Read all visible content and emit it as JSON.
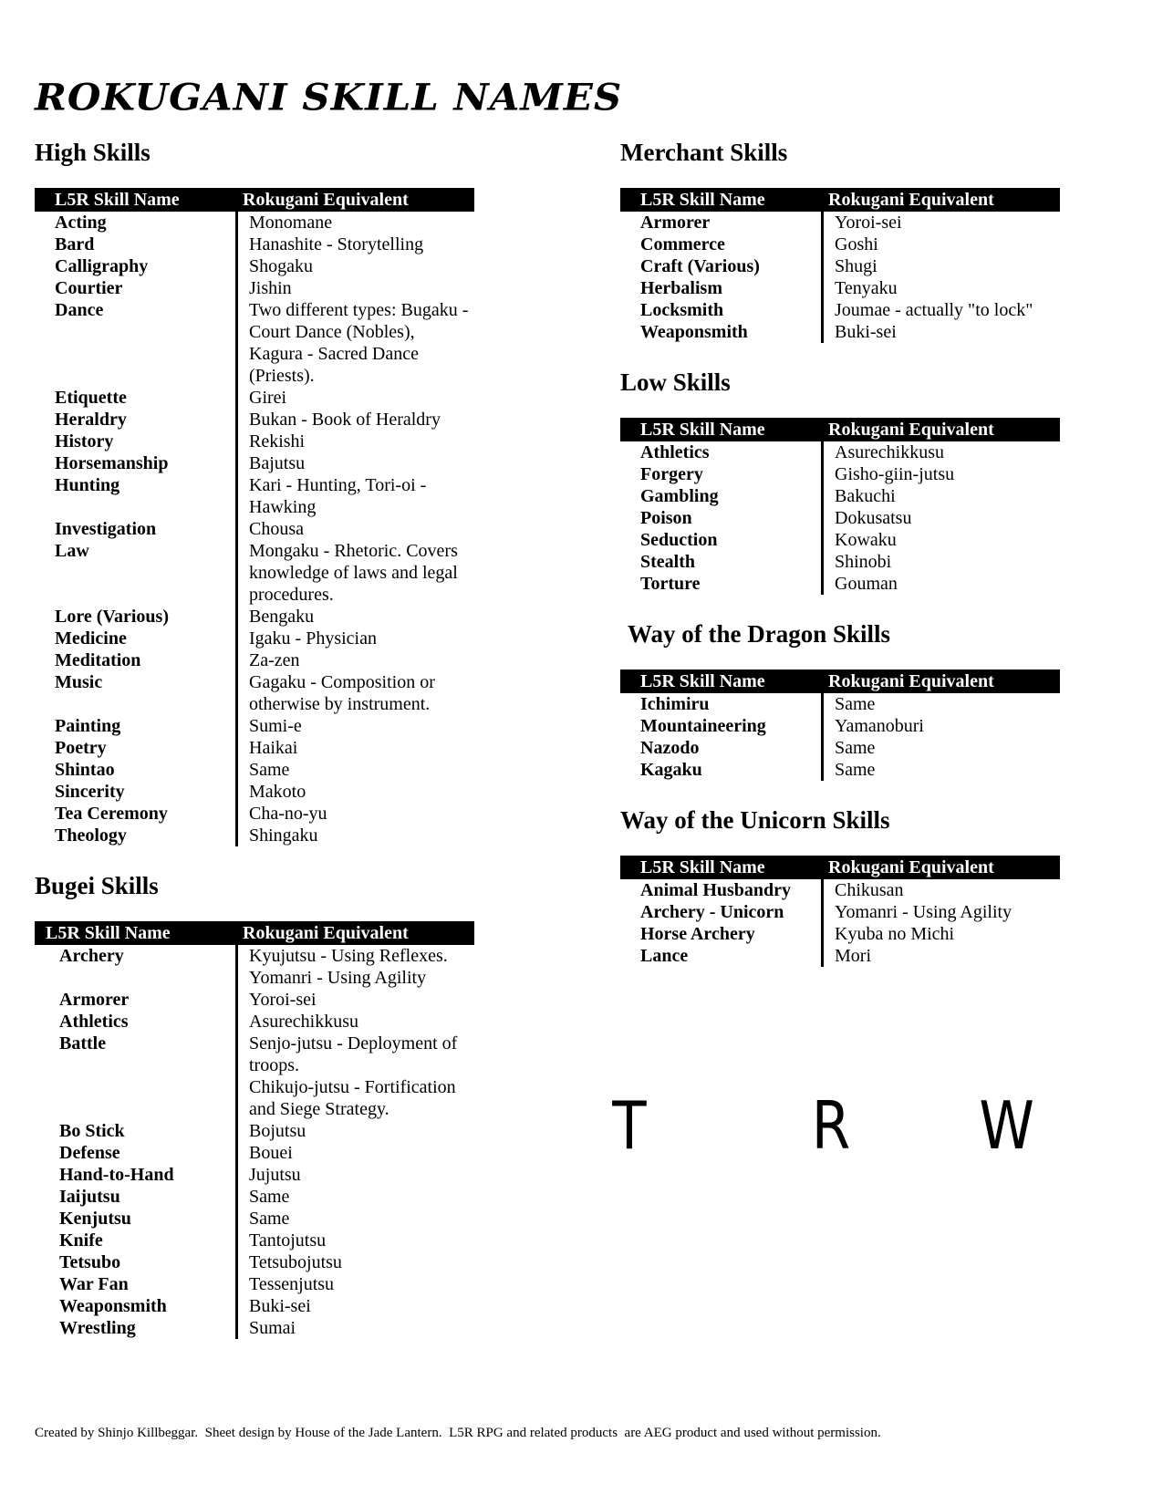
{
  "title": "ROKUGANI SKILL NAMES",
  "table_headers": {
    "skill": "L5R Skill Name",
    "equiv": "Rokugani Equivalent"
  },
  "sections": {
    "high": {
      "title": "High Skills",
      "rows": [
        {
          "skill": "Acting",
          "equiv": "Monomane"
        },
        {
          "skill": "Bard",
          "equiv": "Hanashite - Storytelling"
        },
        {
          "skill": "Calligraphy",
          "equiv": "Shogaku"
        },
        {
          "skill": "Courtier",
          "equiv": "Jishin"
        },
        {
          "skill": "Dance",
          "equiv": "Two different types: Bugaku - Court Dance (Nobles), Kagura - Sacred Dance (Priests)."
        },
        {
          "skill": "Etiquette",
          "equiv": "Girei"
        },
        {
          "skill": "Heraldry",
          "equiv": "Bukan - Book of Heraldry"
        },
        {
          "skill": "History",
          "equiv": "Rekishi"
        },
        {
          "skill": "Horsemanship",
          "equiv": "Bajutsu"
        },
        {
          "skill": "Hunting",
          "equiv": "Kari - Hunting, Tori-oi - Hawking"
        },
        {
          "skill": "Investigation",
          "equiv": "Chousa"
        },
        {
          "skill": "Law",
          "equiv": "Mongaku - Rhetoric. Covers knowledge of laws and legal procedures."
        },
        {
          "skill": "Lore (Various)",
          "equiv": "Bengaku"
        },
        {
          "skill": "Medicine",
          "equiv": "Igaku - Physician"
        },
        {
          "skill": "Meditation",
          "equiv": "Za-zen"
        },
        {
          "skill": "Music",
          "equiv": "Gagaku - Composition or otherwise by instrument."
        },
        {
          "skill": "Painting",
          "equiv": "Sumi-e"
        },
        {
          "skill": "Poetry",
          "equiv": "Haikai"
        },
        {
          "skill": "Shintao",
          "equiv": "Same"
        },
        {
          "skill": "Sincerity",
          "equiv": "Makoto"
        },
        {
          "skill": "Tea Ceremony",
          "equiv": "Cha-no-yu"
        },
        {
          "skill": "Theology",
          "equiv": "Shingaku"
        }
      ]
    },
    "bugei": {
      "title": "Bugei Skills",
      "rows": [
        {
          "skill": "Archery",
          "equiv": "Kyujutsu - Using Reflexes. Yomanri - Using Agility"
        },
        {
          "skill": "Armorer",
          "equiv": "Yoroi-sei"
        },
        {
          "skill": "Athletics",
          "equiv": "Asurechikkusu"
        },
        {
          "skill": "Battle",
          "equiv": "Senjo-jutsu - Deployment of troops.\nChikujo-jutsu - Fortification and Siege Strategy.\n "
        },
        {
          "skill": "Bo Stick",
          "equiv": "Bojutsu"
        },
        {
          "skill": "Defense",
          "equiv": "Bouei"
        },
        {
          "skill": "Hand-to-Hand",
          "equiv": "Jujutsu"
        },
        {
          "skill": "Iaijutsu",
          "equiv": "Same"
        },
        {
          "skill": "Kenjutsu",
          "equiv": "Same"
        },
        {
          "skill": "Knife",
          "equiv": "Tantojutsu"
        },
        {
          "skill": "Tetsubo",
          "equiv": "Tetsubojutsu"
        },
        {
          "skill": "War Fan",
          "equiv": "Tessenjutsu"
        },
        {
          "skill": "Weaponsmith",
          "equiv": "Buki-sei"
        },
        {
          "skill": "Wrestling",
          "equiv": "Sumai"
        }
      ]
    },
    "merchant": {
      "title": "Merchant Skills",
      "rows": [
        {
          "skill": "Armorer",
          "equiv": "Yoroi-sei"
        },
        {
          "skill": "Commerce",
          "equiv": "Goshi"
        },
        {
          "skill": "Craft (Various)",
          "equiv": "Shugi"
        },
        {
          "skill": "Herbalism",
          "equiv": "Tenyaku"
        },
        {
          "skill": "Locksmith",
          "equiv": "Joumae - actually \"to lock\""
        },
        {
          "skill": "Weaponsmith",
          "equiv": "Buki-sei"
        }
      ]
    },
    "low": {
      "title": "Low Skills",
      "rows": [
        {
          "skill": "Athletics",
          "equiv": "Asurechikkusu"
        },
        {
          "skill": "Forgery",
          "equiv": "Gisho-giin-jutsu"
        },
        {
          "skill": "Gambling",
          "equiv": "Bakuchi"
        },
        {
          "skill": "Poison",
          "equiv": "Dokusatsu"
        },
        {
          "skill": "Seduction",
          "equiv": "Kowaku"
        },
        {
          "skill": "Stealth",
          "equiv": "Shinobi"
        },
        {
          "skill": "Torture",
          "equiv": "Gouman"
        }
      ]
    },
    "dragon": {
      "title": "Way of the Dragon Skills",
      "rows": [
        {
          "skill": "Ichimiru",
          "equiv": "Same"
        },
        {
          "skill": "Mountaineering",
          "equiv": "Yamanoburi"
        },
        {
          "skill": "Nazodo",
          "equiv": "Same"
        },
        {
          "skill": "Kagaku",
          "equiv": "Same"
        }
      ]
    },
    "unicorn": {
      "title": "Way of the Unicorn Skills",
      "rows": [
        {
          "skill": "Animal Husbandry",
          "equiv": "Chikusan"
        },
        {
          "skill": "Archery - Unicorn",
          "equiv": "Yomanri - Using Agility"
        },
        {
          "skill": "Horse Archery",
          "equiv": "Kyuba no Michi"
        },
        {
          "skill": "Lance",
          "equiv": "Mori"
        }
      ]
    }
  },
  "trw_letters": [
    "T",
    "R",
    "W"
  ],
  "footer": "Created by Shinjo Killbeggar.  Sheet design by House of the Jade Lantern.  L5R RPG and related products  are AEG product and used without permission."
}
